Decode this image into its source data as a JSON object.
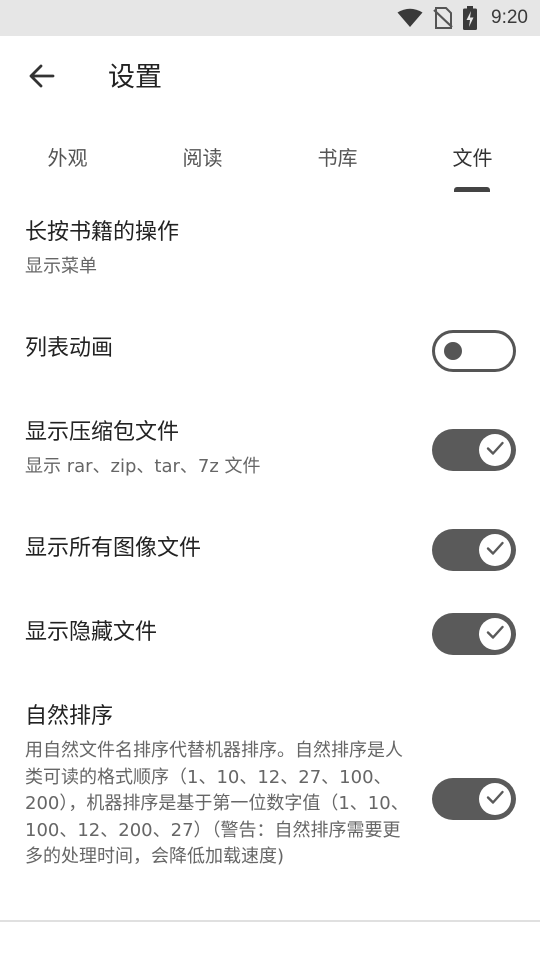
{
  "status_bar": {
    "time": "9:20"
  },
  "app_bar": {
    "title": "设置"
  },
  "tabs": [
    {
      "label": "外观"
    },
    {
      "label": "阅读"
    },
    {
      "label": "书库"
    },
    {
      "label": "文件",
      "active": true
    }
  ],
  "settings": {
    "long_press": {
      "title": "长按书籍的操作",
      "summary": "显示菜单"
    },
    "list_animation": {
      "title": "列表动画",
      "enabled": false
    },
    "show_archives": {
      "title": "显示压缩包文件",
      "summary": "显示 rar、zip、tar、7z 文件",
      "enabled": true
    },
    "show_all_images": {
      "title": "显示所有图像文件",
      "enabled": true
    },
    "show_hidden": {
      "title": "显示隐藏文件",
      "enabled": true
    },
    "natural_sort": {
      "title": "自然排序",
      "summary": "用自然文件名排序代替机器排序。自然排序是人类可读的格式顺序（1、10、12、27、100、200），机器排序是基于第一位数字值（1、10、100、12、200、27）（警告：自然排序需要更多的处理时间，会降低加载速度)",
      "enabled": true
    }
  },
  "colors": {
    "switch_on": "#5a5a5a",
    "status_bar": "#e6e6e6",
    "indicator": "#444444"
  }
}
